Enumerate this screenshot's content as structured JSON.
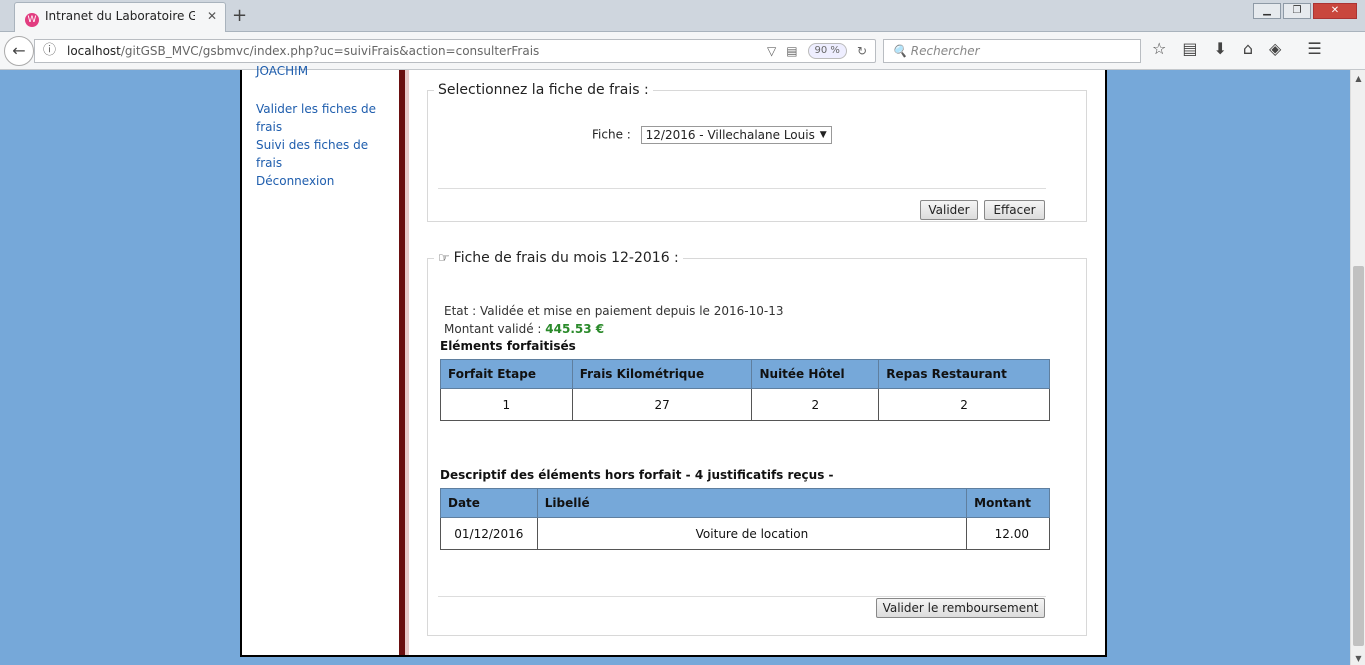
{
  "browser": {
    "tab_title": "Intranet du Laboratoire Galaxy-Swiss Bourdin",
    "tab_icon_letter": "W",
    "new_tab_symbol": "+",
    "url_host": "localhost",
    "url_rest": "/gitGSB_MVC/gsbmvc/index.php?uc=suiviFrais&action=consulterFrais",
    "zoom": "90 %",
    "search_placeholder": "Rechercher"
  },
  "sidebar": {
    "user_name": "JOACHIM",
    "menu": [
      {
        "label": "Valider les fiches de frais"
      },
      {
        "label": "Suivi des fiches de frais"
      },
      {
        "label": "Déconnexion"
      }
    ]
  },
  "selection": {
    "legend": "Selectionnez la fiche de frais :",
    "fiche_label": "Fiche :",
    "fiche_value": "12/2016 - Villechalane Louis",
    "valider_label": "Valider",
    "effacer_label": "Effacer"
  },
  "fiche": {
    "legend": "Fiche de frais du mois 12-2016 :",
    "etat": "Etat : Validée et mise en paiement depuis le 2016-10-13",
    "montant_label": "Montant validé :",
    "montant_value": "445.53 €",
    "forfait_title": "Eléments forfaitisés",
    "forfait_headers": [
      "Forfait Etape",
      "Frais Kilométrique",
      "Nuitée Hôtel",
      "Repas Restaurant"
    ],
    "forfait_values": [
      "1",
      "27",
      "2",
      "2"
    ],
    "horsforfait_title": "Descriptif des éléments hors forfait - 4 justificatifs reçus -",
    "horsforfait_headers": [
      "Date",
      "Libellé",
      "Montant"
    ],
    "horsforfait_rows": [
      {
        "date": "01/12/2016",
        "libelle": "Voiture de location",
        "montant": "12.00"
      }
    ],
    "rembourse_label": "Valider le remboursement"
  }
}
